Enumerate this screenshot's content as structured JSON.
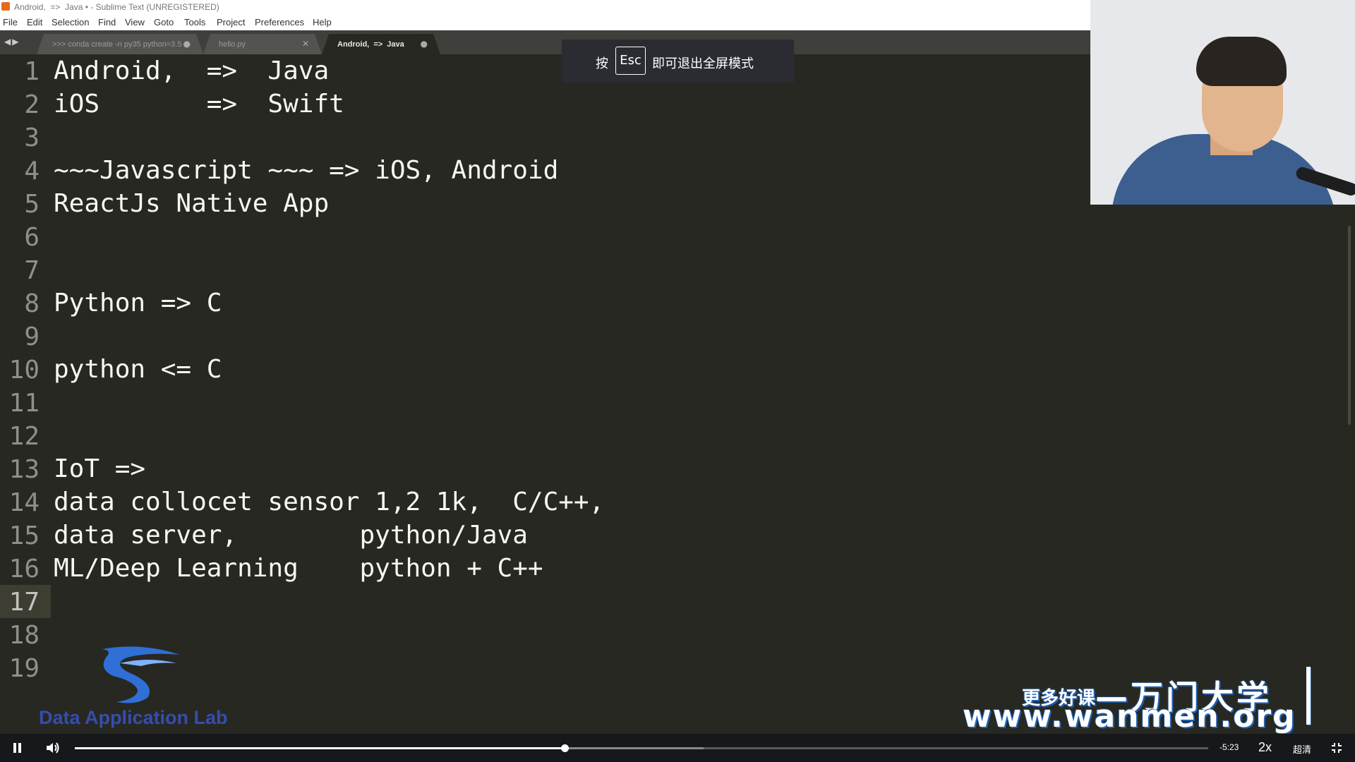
{
  "window": {
    "title": "Android,  =>  Java • - Sublime Text (UNREGISTERED)"
  },
  "menu": [
    "File",
    "Edit",
    "Selection",
    "Find",
    "View",
    "Goto",
    "Tools",
    "Project",
    "Preferences",
    "Help"
  ],
  "tabs": [
    {
      "label": ">>> conda create -n py35 python=3.5",
      "mark": "●",
      "active": false
    },
    {
      "label": "hello.py",
      "mark": "✕",
      "active": false
    },
    {
      "label": "Android,  =>  Java",
      "mark": "●",
      "active": true
    }
  ],
  "editor": {
    "current_line": 17,
    "lines": [
      "Android,  =>  Java",
      "iOS       =>  Swift",
      "",
      "~~~Javascript ~~~ => iOS, Android",
      "ReactJs Native App",
      "",
      "",
      "Python => C",
      "",
      "python <= C",
      "",
      "",
      "IoT =>",
      "data collocet sensor 1,2 1k,  C/C++,",
      "data server,        python/Java",
      "ML/Deep Learning    python + C++",
      "",
      "",
      ""
    ]
  },
  "toast": {
    "prefix": "按",
    "key": "Esc",
    "suffix": "即可退出全屏模式"
  },
  "logo": {
    "text": "Data Application Lab"
  },
  "watermark": {
    "line1_small": "更多好课",
    "line1_big": "—万门大学",
    "line2": "www.wanmen.org"
  },
  "player": {
    "progress": 0.432,
    "buffered": 0.555,
    "time_remaining": "-5:23",
    "speed": "2x",
    "quality": "超清"
  },
  "colors": {
    "editor_bg": "#272822",
    "text": "#f8f8f2",
    "gutter": "#90908a",
    "logo_blue": "#3a5bd9"
  }
}
